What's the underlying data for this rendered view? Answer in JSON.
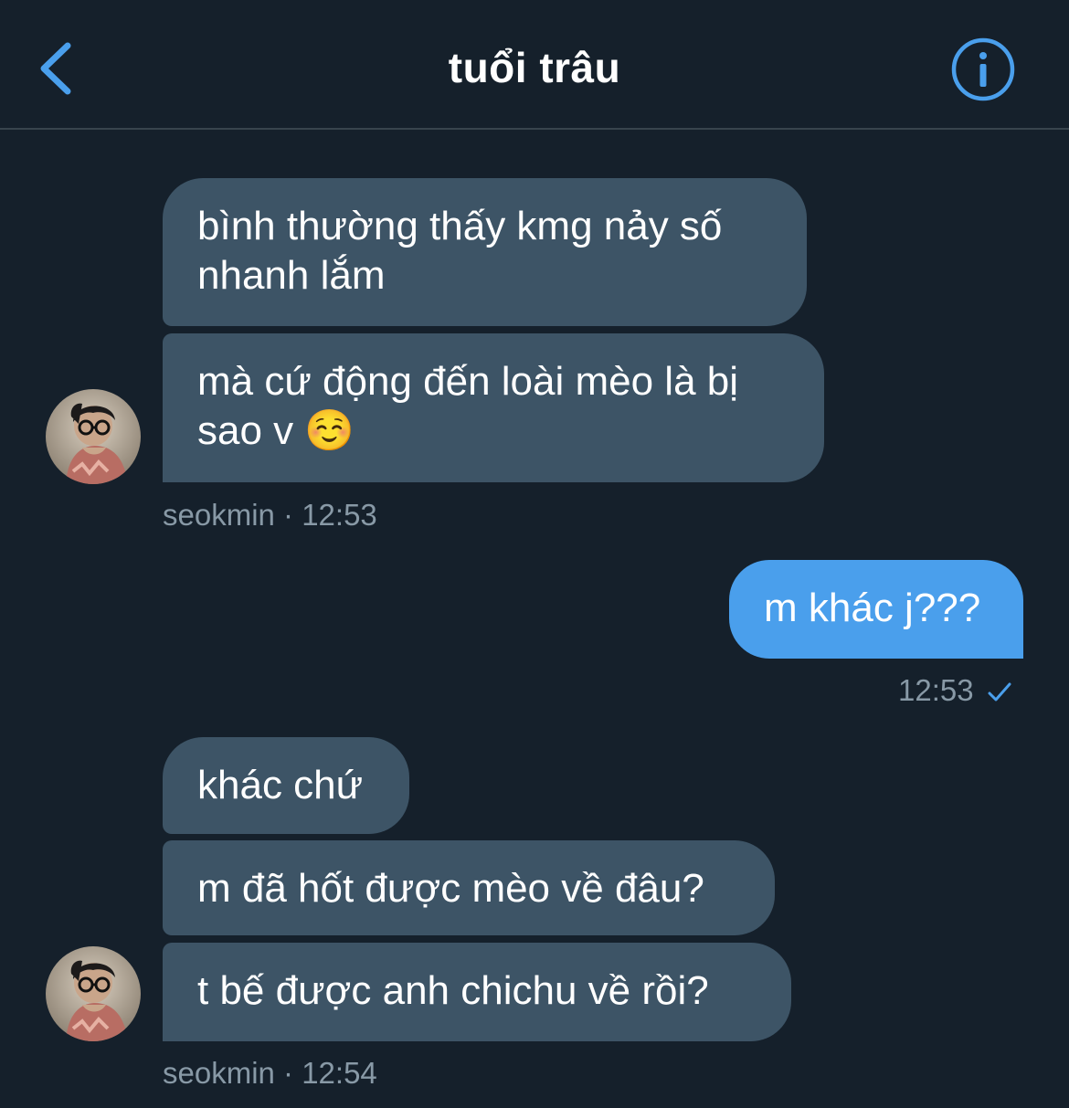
{
  "header": {
    "title": "tuổi trâu",
    "back_icon": "chevron-left-icon",
    "info_icon": "info-icon",
    "accent_color": "#4a9fec"
  },
  "colors": {
    "background": "#15202b",
    "incoming_bubble": "#3d5466",
    "outgoing_bubble": "#4a9fec",
    "meta_text": "#8899a6"
  },
  "messages": [
    {
      "text": "bình thường thấy kmg nảy số\nnhanh lắm",
      "direction": "incoming"
    },
    {
      "text": "mà cứ động đến loài mèo là bị\nsao v ☺️",
      "direction": "incoming"
    },
    {
      "text": "m khác j???",
      "direction": "outgoing"
    },
    {
      "text": "khác chứ",
      "direction": "incoming"
    },
    {
      "text": "m đã hốt được mèo về đâu?",
      "direction": "incoming"
    },
    {
      "text": "t bế được anh chichu về rồi?",
      "direction": "incoming"
    }
  ],
  "meta": {
    "group1": "seokmin · 12:53",
    "outgoing": "12:53",
    "group2": "seokmin · 12:54"
  }
}
